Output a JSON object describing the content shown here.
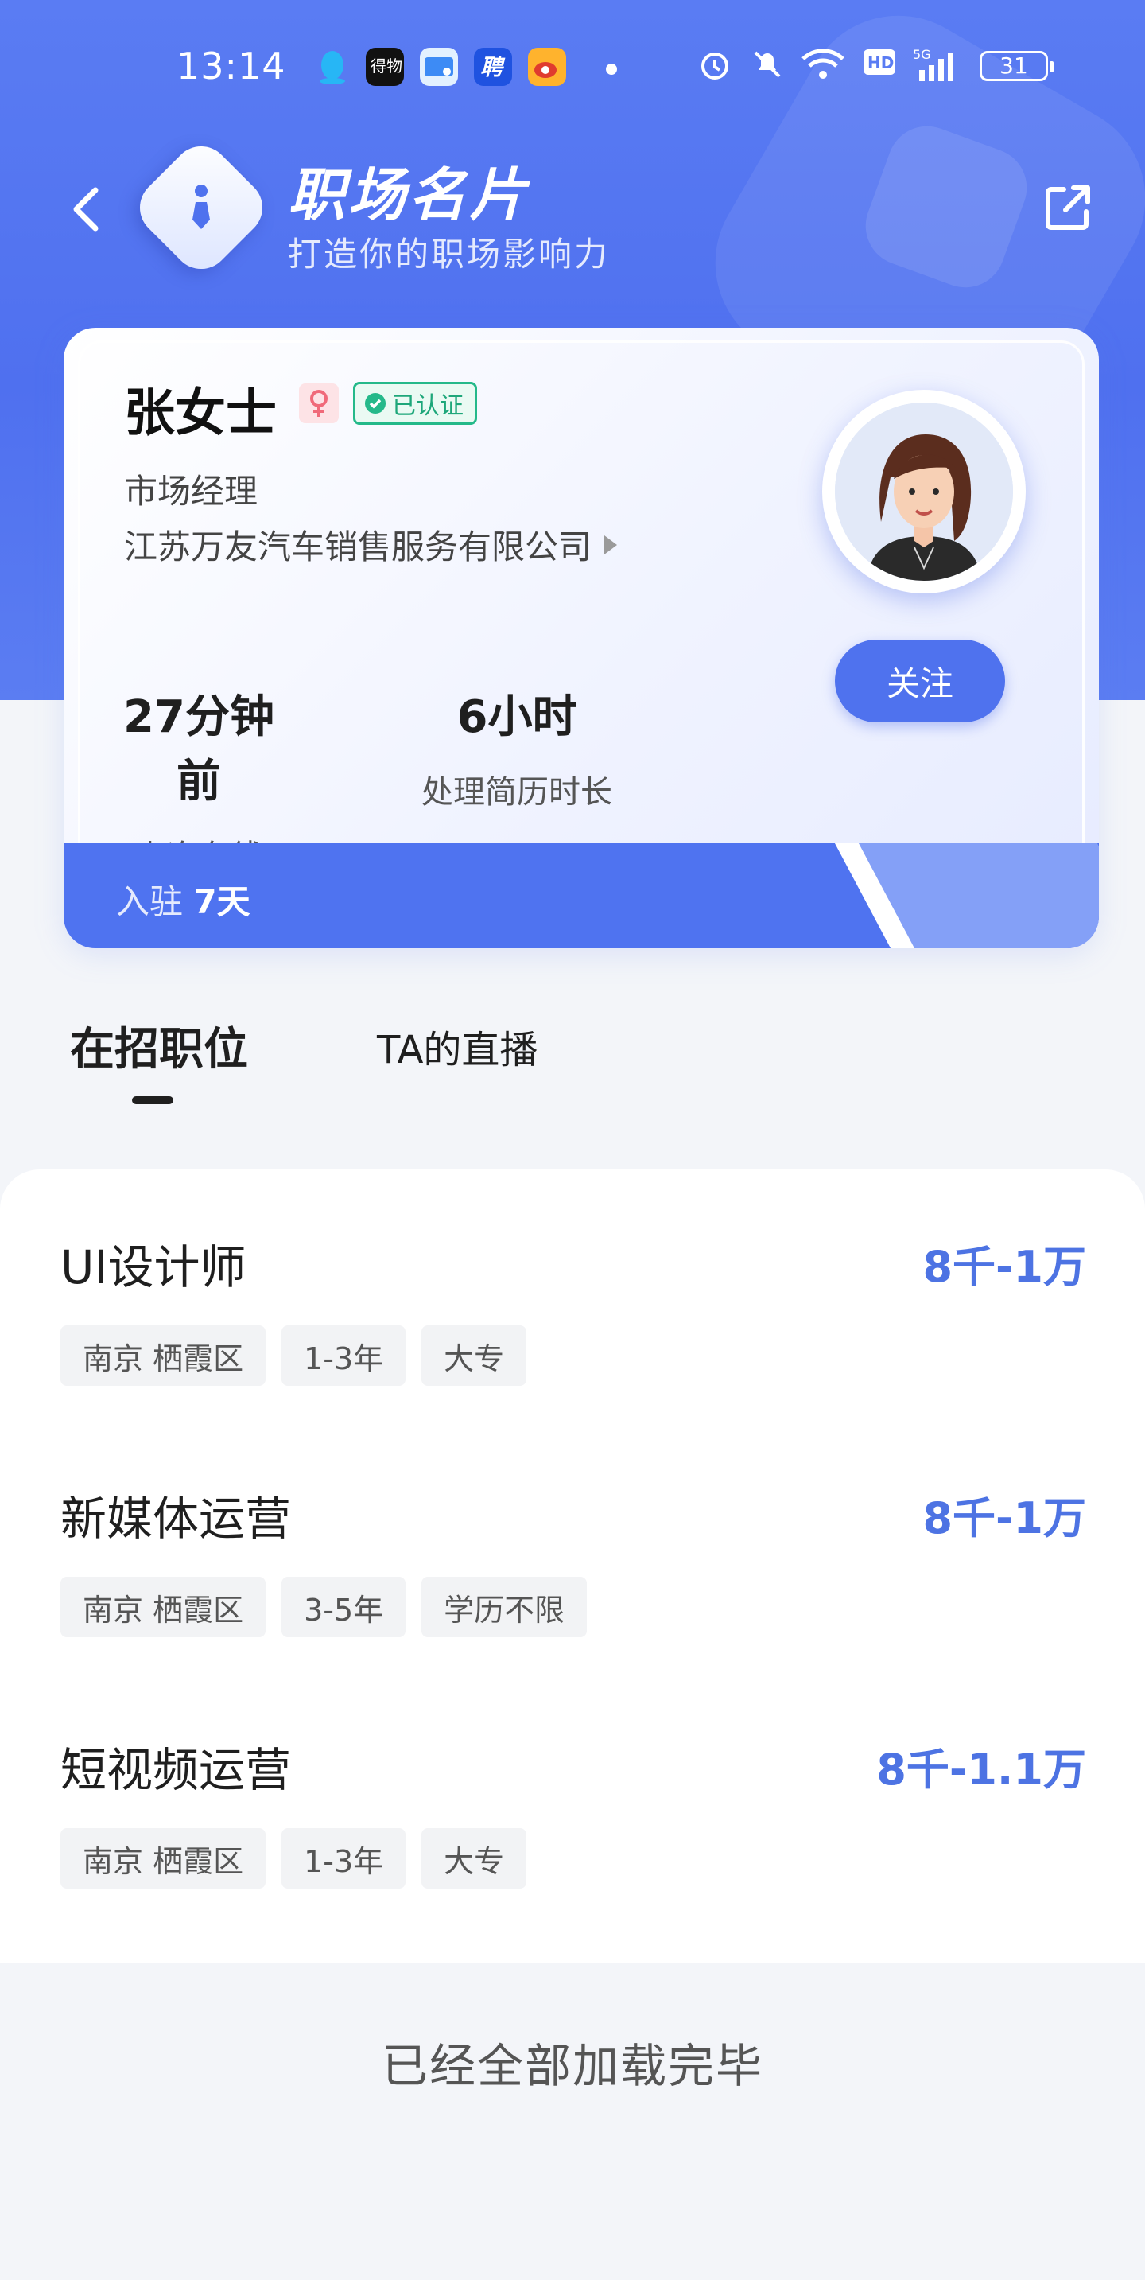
{
  "status_bar": {
    "time": "13:14",
    "apps": [
      "qq-icon",
      "dewu-icon",
      "mail-icon",
      "zhaopin-icon",
      "weibo-icon"
    ],
    "indicators": [
      "alarm-icon",
      "mute-icon",
      "wifi-icon",
      "hd-icon",
      "signal-5g-icon"
    ],
    "battery": "31"
  },
  "header": {
    "title": "职场名片",
    "subtitle": "打造你的职场影响力",
    "back_icon": "back-arrow-icon",
    "share_icon": "share-icon"
  },
  "profile": {
    "name": "张女士",
    "gender_icon": "female-icon",
    "verified_label": "已认证",
    "job_title": "市场经理",
    "company": "江苏万友汽车销售服务有限公司",
    "follow_label": "关注",
    "stats": [
      {
        "value": "27分钟前",
        "label": "上次在线"
      },
      {
        "value": "6小时",
        "label": "处理简历时长"
      }
    ],
    "join_prefix": "入驻",
    "join_days": "7天"
  },
  "tabs": [
    {
      "label": "在招职位",
      "active": true
    },
    {
      "label": "TA的直播",
      "active": false
    }
  ],
  "jobs": [
    {
      "name": "UI设计师",
      "salary": "8千-1万",
      "tags": [
        "南京 栖霞区",
        "1-3年",
        "大专"
      ]
    },
    {
      "name": "新媒体运营",
      "salary": "8千-1万",
      "tags": [
        "南京 栖霞区",
        "3-5年",
        "学历不限"
      ]
    },
    {
      "name": "短视频运营",
      "salary": "8千-1.1万",
      "tags": [
        "南京 栖霞区",
        "1-3年",
        "大专"
      ]
    }
  ],
  "footer_text": "已经全部加载完毕",
  "colors": {
    "brand_blue": "#4f72ee",
    "salary_blue": "#4d73e3",
    "verified_green": "#25b98a"
  }
}
